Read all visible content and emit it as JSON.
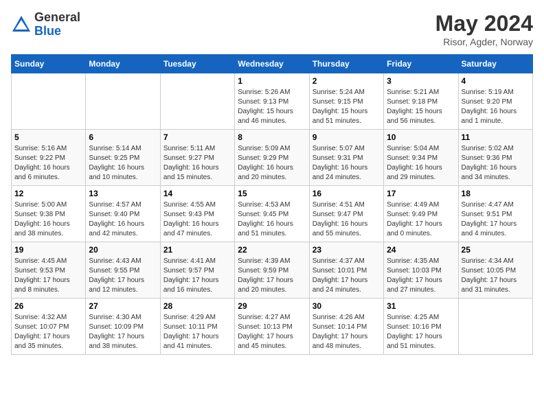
{
  "header": {
    "logo_general": "General",
    "logo_blue": "Blue",
    "month_year": "May 2024",
    "location": "Risor, Agder, Norway"
  },
  "days_of_week": [
    "Sunday",
    "Monday",
    "Tuesday",
    "Wednesday",
    "Thursday",
    "Friday",
    "Saturday"
  ],
  "weeks": [
    [
      {
        "day": "",
        "info": ""
      },
      {
        "day": "",
        "info": ""
      },
      {
        "day": "",
        "info": ""
      },
      {
        "day": "1",
        "info": "Sunrise: 5:26 AM\nSunset: 9:13 PM\nDaylight: 15 hours\nand 46 minutes."
      },
      {
        "day": "2",
        "info": "Sunrise: 5:24 AM\nSunset: 9:15 PM\nDaylight: 15 hours\nand 51 minutes."
      },
      {
        "day": "3",
        "info": "Sunrise: 5:21 AM\nSunset: 9:18 PM\nDaylight: 15 hours\nand 56 minutes."
      },
      {
        "day": "4",
        "info": "Sunrise: 5:19 AM\nSunset: 9:20 PM\nDaylight: 16 hours\nand 1 minute."
      }
    ],
    [
      {
        "day": "5",
        "info": "Sunrise: 5:16 AM\nSunset: 9:22 PM\nDaylight: 16 hours\nand 6 minutes."
      },
      {
        "day": "6",
        "info": "Sunrise: 5:14 AM\nSunset: 9:25 PM\nDaylight: 16 hours\nand 10 minutes."
      },
      {
        "day": "7",
        "info": "Sunrise: 5:11 AM\nSunset: 9:27 PM\nDaylight: 16 hours\nand 15 minutes."
      },
      {
        "day": "8",
        "info": "Sunrise: 5:09 AM\nSunset: 9:29 PM\nDaylight: 16 hours\nand 20 minutes."
      },
      {
        "day": "9",
        "info": "Sunrise: 5:07 AM\nSunset: 9:31 PM\nDaylight: 16 hours\nand 24 minutes."
      },
      {
        "day": "10",
        "info": "Sunrise: 5:04 AM\nSunset: 9:34 PM\nDaylight: 16 hours\nand 29 minutes."
      },
      {
        "day": "11",
        "info": "Sunrise: 5:02 AM\nSunset: 9:36 PM\nDaylight: 16 hours\nand 34 minutes."
      }
    ],
    [
      {
        "day": "12",
        "info": "Sunrise: 5:00 AM\nSunset: 9:38 PM\nDaylight: 16 hours\nand 38 minutes."
      },
      {
        "day": "13",
        "info": "Sunrise: 4:57 AM\nSunset: 9:40 PM\nDaylight: 16 hours\nand 42 minutes."
      },
      {
        "day": "14",
        "info": "Sunrise: 4:55 AM\nSunset: 9:43 PM\nDaylight: 16 hours\nand 47 minutes."
      },
      {
        "day": "15",
        "info": "Sunrise: 4:53 AM\nSunset: 9:45 PM\nDaylight: 16 hours\nand 51 minutes."
      },
      {
        "day": "16",
        "info": "Sunrise: 4:51 AM\nSunset: 9:47 PM\nDaylight: 16 hours\nand 55 minutes."
      },
      {
        "day": "17",
        "info": "Sunrise: 4:49 AM\nSunset: 9:49 PM\nDaylight: 17 hours\nand 0 minutes."
      },
      {
        "day": "18",
        "info": "Sunrise: 4:47 AM\nSunset: 9:51 PM\nDaylight: 17 hours\nand 4 minutes."
      }
    ],
    [
      {
        "day": "19",
        "info": "Sunrise: 4:45 AM\nSunset: 9:53 PM\nDaylight: 17 hours\nand 8 minutes."
      },
      {
        "day": "20",
        "info": "Sunrise: 4:43 AM\nSunset: 9:55 PM\nDaylight: 17 hours\nand 12 minutes."
      },
      {
        "day": "21",
        "info": "Sunrise: 4:41 AM\nSunset: 9:57 PM\nDaylight: 17 hours\nand 16 minutes."
      },
      {
        "day": "22",
        "info": "Sunrise: 4:39 AM\nSunset: 9:59 PM\nDaylight: 17 hours\nand 20 minutes."
      },
      {
        "day": "23",
        "info": "Sunrise: 4:37 AM\nSunset: 10:01 PM\nDaylight: 17 hours\nand 24 minutes."
      },
      {
        "day": "24",
        "info": "Sunrise: 4:35 AM\nSunset: 10:03 PM\nDaylight: 17 hours\nand 27 minutes."
      },
      {
        "day": "25",
        "info": "Sunrise: 4:34 AM\nSunset: 10:05 PM\nDaylight: 17 hours\nand 31 minutes."
      }
    ],
    [
      {
        "day": "26",
        "info": "Sunrise: 4:32 AM\nSunset: 10:07 PM\nDaylight: 17 hours\nand 35 minutes."
      },
      {
        "day": "27",
        "info": "Sunrise: 4:30 AM\nSunset: 10:09 PM\nDaylight: 17 hours\nand 38 minutes."
      },
      {
        "day": "28",
        "info": "Sunrise: 4:29 AM\nSunset: 10:11 PM\nDaylight: 17 hours\nand 41 minutes."
      },
      {
        "day": "29",
        "info": "Sunrise: 4:27 AM\nSunset: 10:13 PM\nDaylight: 17 hours\nand 45 minutes."
      },
      {
        "day": "30",
        "info": "Sunrise: 4:26 AM\nSunset: 10:14 PM\nDaylight: 17 hours\nand 48 minutes."
      },
      {
        "day": "31",
        "info": "Sunrise: 4:25 AM\nSunset: 10:16 PM\nDaylight: 17 hours\nand 51 minutes."
      },
      {
        "day": "",
        "info": ""
      }
    ]
  ]
}
